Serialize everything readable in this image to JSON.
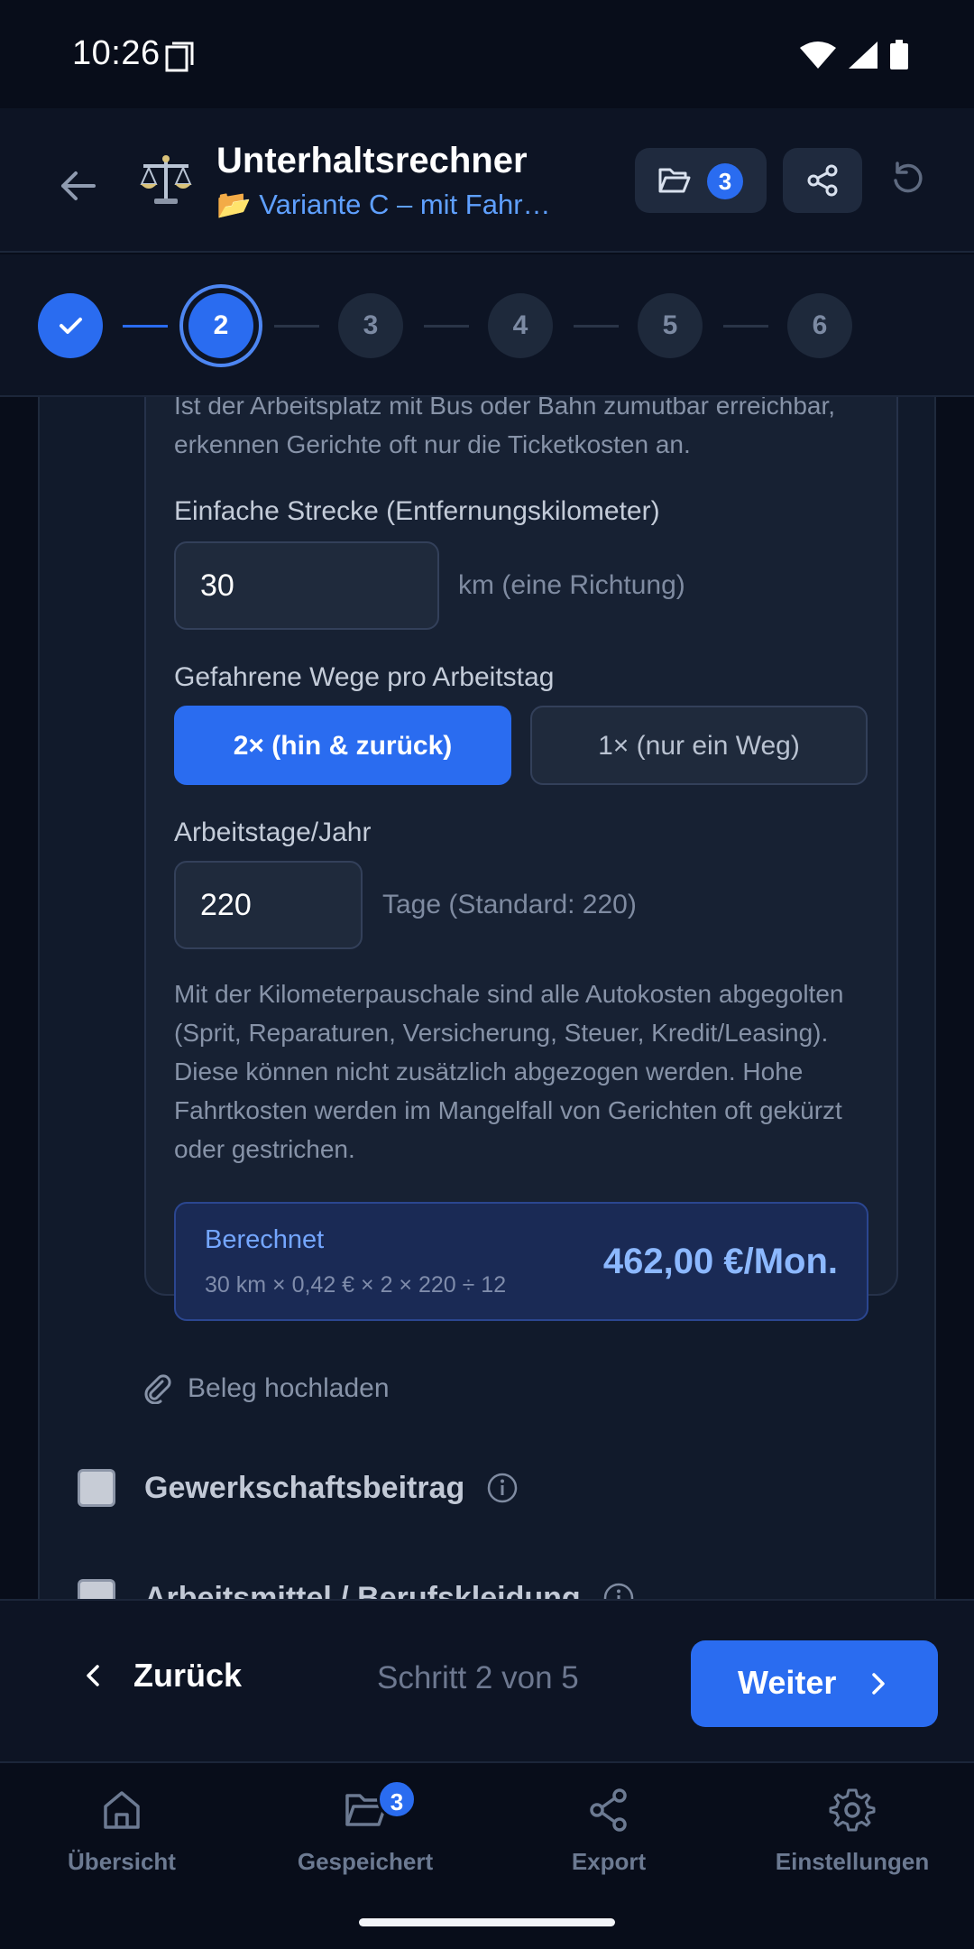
{
  "status_bar": {
    "time": "10:26"
  },
  "header": {
    "title": "Unterhaltsrechner",
    "subtitle": "📂 Variante C – mit Fahr…",
    "saved_count": "3"
  },
  "stepper": {
    "steps": [
      "2",
      "3",
      "4",
      "5",
      "6"
    ],
    "current": 2
  },
  "form": {
    "hint_top": "Ist der Arbeitsplatz mit Bus oder Bahn zumutbar erreichbar, erkennen Gerichte oft nur die Ticketkosten an.",
    "distance_label": "Einfache Strecke (Entfernungskilometer)",
    "distance_value": "30",
    "distance_unit": "km (eine Richtung)",
    "trips_label": "Gefahrene Wege pro Arbeitstag",
    "trips_option_two": "2× (hin & zurück)",
    "trips_option_one": "1× (nur ein Weg)",
    "workdays_label": "Arbeitstage/Jahr",
    "workdays_value": "220",
    "workdays_unit": "Tage (Standard: 220)",
    "info_text": "Mit der Kilometerpauschale sind alle Autokosten abgegolten (Sprit, Reparaturen, Versicherung, Steuer, Kredit/Leasing). Diese können nicht zusätzlich abgezogen werden. Hohe Fahrtkosten werden im Mangelfall von Gerichten oft gekürzt oder gestrichen.",
    "calc_label": "Berechnet",
    "calc_formula": "30 km × 0,42 € × 2 × 220 ÷ 12",
    "calc_value": "462,00 €/Mon.",
    "upload_label": "Beleg hochladen",
    "union_label": "Gewerkschaftsbeitrag",
    "next_item_label": "Arbeitsmittel / Berufskleidung"
  },
  "actions": {
    "back_label": "Zurück",
    "step_text": "Schritt 2 von 5",
    "next_label": "Weiter"
  },
  "nav": {
    "items": [
      {
        "label": "Übersicht",
        "icon": "home-icon"
      },
      {
        "label": "Gespeichert",
        "icon": "folder-icon"
      },
      {
        "label": "Export",
        "icon": "share-icon"
      },
      {
        "label": "Einstellungen",
        "icon": "gear-icon"
      }
    ],
    "saved_badge": "3"
  },
  "colors": {
    "accent": "#2a6cf0",
    "background": "#080d1a",
    "card": "#172133",
    "calc_value": "#8cb8ff"
  }
}
